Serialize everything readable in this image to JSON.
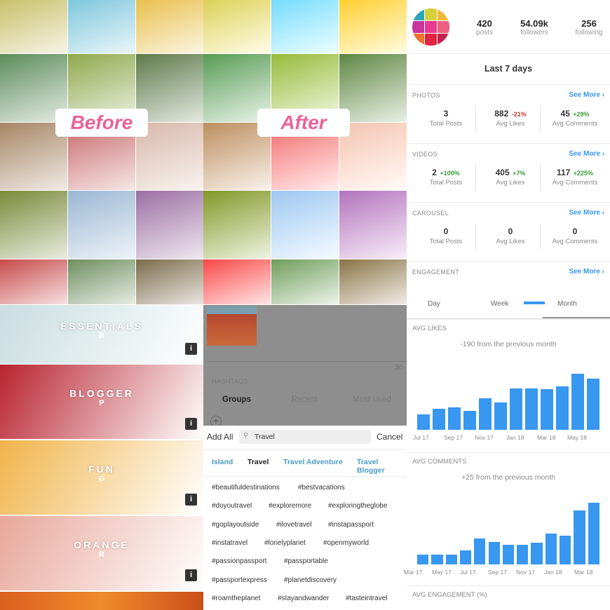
{
  "comparison": {
    "before_label": "Before",
    "after_label": "After"
  },
  "photo_colors": [
    "#c9c06a",
    "#7ec7dd",
    "#e9c04e",
    "#5c8c5a",
    "#8fa94d",
    "#5d7a4a",
    "#a68564",
    "#c96a6a",
    "#d8b7a8",
    "#7a8a3a",
    "#9ab7d4",
    "#9c6fa3",
    "#c84a4a",
    "#6e8f60",
    "#7b6b4b"
  ],
  "presets": [
    {
      "title": "ESSENTIALS",
      "sub": "B",
      "color": "#c9dde0",
      "info": "i"
    },
    {
      "title": "BLOGGER",
      "sub": "P",
      "color": "#b8232f",
      "info": "i"
    },
    {
      "title": "FUN",
      "sub": "G",
      "color": "#f0b44a",
      "info": "i"
    },
    {
      "title": "ORANGE",
      "sub": "R",
      "color": "#e8a79a",
      "info": "i"
    }
  ],
  "hashtag_panel": {
    "count": "30",
    "heading": "HASHTAGS",
    "tabs": [
      {
        "label": "Groups",
        "active": true
      },
      {
        "label": "Recent",
        "active": false
      },
      {
        "label": "Most Used",
        "active": false
      }
    ],
    "add_all": "Add All",
    "search_value": "Travel",
    "cancel": "Cancel",
    "categories": [
      {
        "label": "Island",
        "active": false
      },
      {
        "label": "Travel",
        "active": true
      },
      {
        "label": "Travel Adventure",
        "active": false
      },
      {
        "label": "Travel Blogger",
        "active": false
      }
    ],
    "tag_rows": [
      [
        "#beautifuldestinations",
        "#bestvacations"
      ],
      [
        "#doyoutravel",
        "#exploremore",
        "#exploringtheglobe"
      ],
      [
        "#goplayoutside",
        "#ilovetravel",
        "#instapassport"
      ],
      [
        "#instatravel",
        "#lonelyplanet",
        "#openmyworld"
      ],
      [
        "#passionpassport",
        "#passportable"
      ],
      [
        "#passportexpress",
        "#planetdiscovery"
      ],
      [
        "#roamtheplanet",
        "#stayandwander",
        "#tasteintravel"
      ]
    ]
  },
  "insights": {
    "profile": {
      "posts": "420",
      "posts_label": "posts",
      "followers": "54.09k",
      "followers_label": "followers",
      "following": "256",
      "following_label": "following"
    },
    "period": "Last 7 days",
    "see_more": "See More",
    "sections": [
      {
        "title": "PHOTOS",
        "cells": [
          {
            "v": "3",
            "p": "",
            "l": "Total Posts"
          },
          {
            "v": "882",
            "p": "-21%",
            "l": "Avg Likes"
          },
          {
            "v": "45",
            "p": "+29%",
            "l": "Avg Comments"
          }
        ]
      },
      {
        "title": "VIDEOS",
        "cells": [
          {
            "v": "2",
            "p": "+100%",
            "l": "Total Posts"
          },
          {
            "v": "405",
            "p": "+7%",
            "l": "Avg Likes"
          },
          {
            "v": "117",
            "p": "+225%",
            "l": "Avg Comments"
          }
        ]
      },
      {
        "title": "CAROUSEL",
        "cells": [
          {
            "v": "0",
            "p": "",
            "l": "Total Posts"
          },
          {
            "v": "0",
            "p": "",
            "l": "Avg Likes"
          },
          {
            "v": "0",
            "p": "",
            "l": "Avg Comments"
          }
        ]
      },
      {
        "title": "ENGAGEMENT",
        "cells": []
      }
    ],
    "engagement_tabs": [
      "Day",
      "Week",
      "Month"
    ],
    "accent": "#3897f0"
  },
  "chart_data": [
    {
      "type": "bar",
      "title": "AVG LIKES",
      "subtitle": "-190 from the previous month",
      "tick_labels": [
        "Jul 17",
        "Sep 17",
        "Nov 17",
        "Jan 18",
        "Mar 18",
        "May 18"
      ],
      "values": [
        63,
        88,
        92,
        80,
        130,
        113,
        172,
        172,
        168,
        182,
        233,
        212
      ],
      "grid": false
    },
    {
      "type": "bar",
      "title": "AVG COMMENTS",
      "subtitle": "+25 from the previous month",
      "tick_labels": [
        "Mar 17",
        "May 17",
        "Jul 17",
        "Sep 17",
        "Nov 17",
        "Jan 18",
        "Mar 18"
      ],
      "values": [
        40,
        42,
        40,
        58,
        108,
        95,
        82,
        82,
        92,
        130,
        120,
        228,
        260
      ],
      "grid": false
    },
    {
      "type": "bar",
      "title": "AVG ENGAGEMENT (%)"
    }
  ]
}
